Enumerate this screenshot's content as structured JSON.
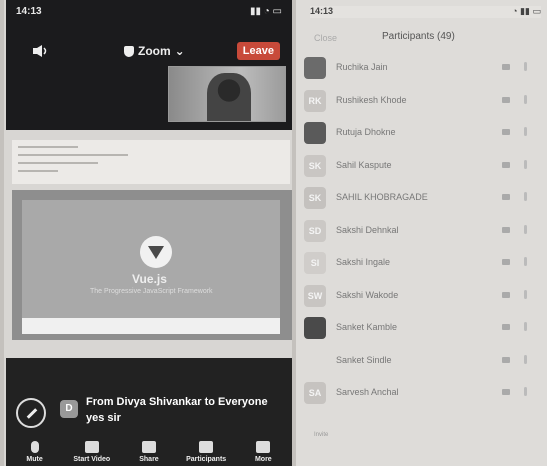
{
  "left_phone": {
    "status_time": "14:13",
    "meeting_menu": "Zoom",
    "leave_label": "Leave",
    "slide": {
      "title": "Vue.js",
      "subtitle": "The Progressive JavaScript Framework"
    },
    "chat": {
      "avatar_initial": "D",
      "from": "From Divya Shivankar to Everyone",
      "message": "yes sir"
    },
    "toolbar": [
      {
        "label": "Mute",
        "icon": "microphone-icon"
      },
      {
        "label": "Start Video",
        "icon": "video-camera-icon"
      },
      {
        "label": "Share",
        "icon": "share-screen-icon"
      },
      {
        "label": "Participants",
        "icon": "participants-icon"
      },
      {
        "label": "More",
        "icon": "more-icon"
      }
    ]
  },
  "right_phone": {
    "status_time": "14:13",
    "close_label": "Close",
    "title": "Participants (49)",
    "participants": [
      {
        "initials": "",
        "name": "Ruchika Jain",
        "color": "#6b6b6b",
        "photo": true
      },
      {
        "initials": "RK",
        "name": "Rushikesh Khode",
        "color": "#c7c4c1",
        "photo": false
      },
      {
        "initials": "",
        "name": "Rutuja Dhokne",
        "color": "#5a5a5a",
        "photo": true
      },
      {
        "initials": "SK",
        "name": "Sahil Kaspute",
        "color": "#c9c6c3",
        "photo": false
      },
      {
        "initials": "SK",
        "name": "SAHIL KHOBRAGADE",
        "color": "#c4c1be",
        "photo": false
      },
      {
        "initials": "SD",
        "name": "Sakshi Dehnkal",
        "color": "#cbc8c5",
        "photo": false
      },
      {
        "initials": "SI",
        "name": "Sakshi Ingale",
        "color": "#d0cdca",
        "photo": false
      },
      {
        "initials": "SW",
        "name": "Sakshi Wakode",
        "color": "#c8c5c2",
        "photo": false
      },
      {
        "initials": "",
        "name": "Sanket Kamble",
        "color": "#4a4a4a",
        "photo": true
      },
      {
        "initials": "",
        "name": "Sanket Sindle",
        "color": "#dedcd9",
        "photo": false
      },
      {
        "initials": "SA",
        "name": "Sarvesh Anchal",
        "color": "#c6c3c0",
        "photo": false
      }
    ],
    "invite_label": "Invite"
  }
}
